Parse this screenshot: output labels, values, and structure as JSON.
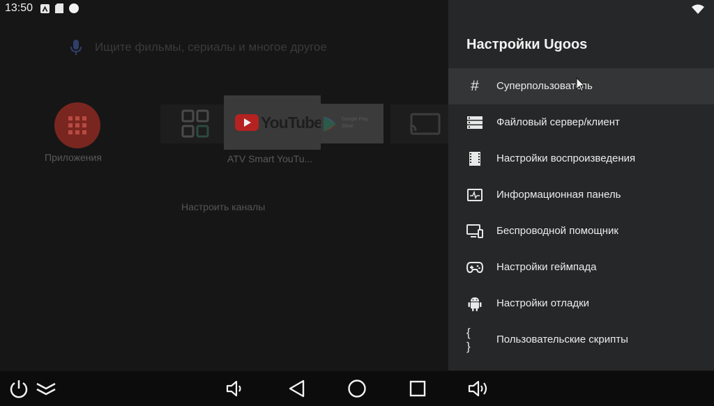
{
  "status_bar": {
    "time": "13:50",
    "icons": [
      "a-notification-icon",
      "sd-card-icon",
      "circle-notification-icon"
    ],
    "right_icons": [
      "wifi-icon"
    ]
  },
  "launcher": {
    "search_placeholder": "Ищите фильмы, сериалы и многое другое",
    "apps_label": "Приложения",
    "youtube_logo_text": "YouTube",
    "youtube_caption": "ATV Smart YouTu...",
    "google_play_text": "Google Play Store",
    "channels_label": "Настроить каналы",
    "colors": {
      "apps_button": "#7a2620",
      "youtube_red": "#cc1f1f"
    }
  },
  "settings_panel": {
    "title": "Настройки Ugoos",
    "items": [
      {
        "label": "Суперпользователь",
        "icon": "hash-icon",
        "selected": true
      },
      {
        "label": "Файловый сервер/клиент",
        "icon": "server-icon"
      },
      {
        "label": "Настройки воспроизведения",
        "icon": "film-icon"
      },
      {
        "label": "Информационная панель",
        "icon": "monitor-pulse-icon"
      },
      {
        "label": "Беспроводной помощник",
        "icon": "devices-icon"
      },
      {
        "label": "Настройки геймпада",
        "icon": "gamepad-icon"
      },
      {
        "label": "Настройки отладки",
        "icon": "android-icon"
      },
      {
        "label": "Пользовательские скрипты",
        "icon": "braces-icon"
      }
    ]
  },
  "nav_bar": {
    "buttons": [
      "power-icon",
      "collapse-icon",
      "volume-down-icon",
      "back-icon",
      "home-icon",
      "recents-icon",
      "volume-up-icon"
    ]
  }
}
